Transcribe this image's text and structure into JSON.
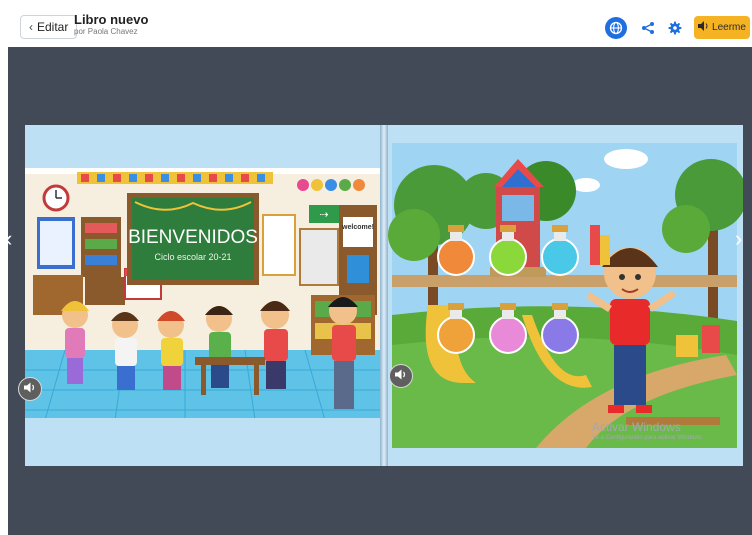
{
  "header": {
    "back_label": "Editar",
    "title": "Libro nuevo",
    "author": "por Paola Chavez",
    "read_label": "Leerme"
  },
  "colors": {
    "accent": "#1f6fe0",
    "read_button": "#f5b324",
    "viewer_bg": "#424a57"
  },
  "icons": {
    "back": "chevron-left-icon",
    "globe": "globe-icon",
    "share": "share-icon",
    "settings": "gear-icon",
    "read": "speaker-icon",
    "prev": "chevron-left-icon",
    "next": "chevron-right-icon",
    "audio": "speaker-icon"
  },
  "book": {
    "left_page": {
      "chalkboard_title": "BIENVENIDOS",
      "chalkboard_subtitle": "Ciclo escolar 20-21",
      "door_sign": "welcome!"
    }
  },
  "watermark": {
    "title": "Activar Windows",
    "subtitle": "Ve a Configuración para activar Windows."
  }
}
